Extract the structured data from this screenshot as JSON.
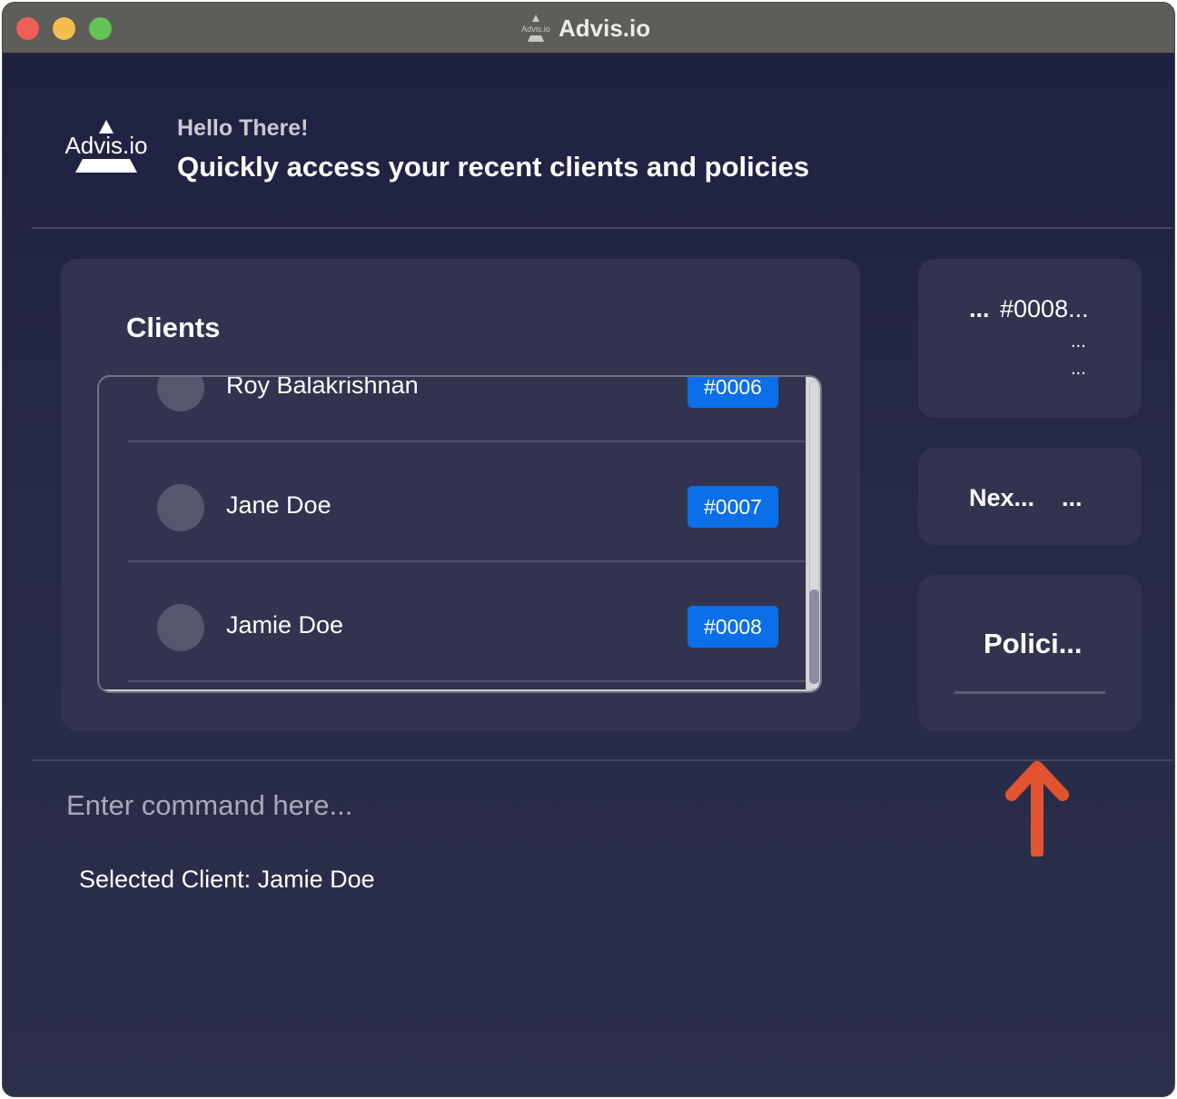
{
  "window": {
    "title": "Advis.io"
  },
  "logo": {
    "text": "Advis.io",
    "small_text": "Advis.io"
  },
  "header": {
    "greeting": "Hello There!",
    "tagline": "Quickly access your recent clients and policies"
  },
  "clients": {
    "title": "Clients",
    "rows": [
      {
        "name": "Roy Balakrishnan",
        "id": "#0006"
      },
      {
        "name": "Jane Doe",
        "id": "#0007"
      },
      {
        "name": "Jamie Doe",
        "id": "#0008"
      }
    ]
  },
  "side_panels": {
    "client_card": {
      "prefix": "...",
      "id": "#0008...",
      "line2": "...",
      "line3": "..."
    },
    "next_card": {
      "label": "Nex...",
      "value": "..."
    },
    "policies_card": {
      "label": "Polici..."
    }
  },
  "command": {
    "placeholder": "Enter command here..."
  },
  "status": {
    "selected_client": "Selected Client: Jamie Doe"
  },
  "colors": {
    "background": "#262944",
    "card": "#31334f",
    "badge": "#0a6fe8",
    "annotation_arrow": "#e2542f"
  },
  "icons": [
    "close-icon",
    "minimize-icon",
    "maximize-icon",
    "advis-logo-icon",
    "avatar-icon",
    "up-arrow-icon"
  ]
}
